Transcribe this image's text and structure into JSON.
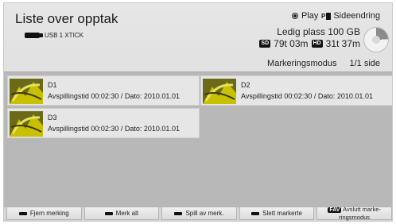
{
  "header": {
    "title": "Liste over opptak",
    "device_label": "USB 1 XTICK",
    "play_label": "Play",
    "page_change_label": "Sideendring",
    "free_space": "Ledig plass 100 GB",
    "sd_badge": "SD",
    "sd_time": "79t 03m",
    "hd_badge": "HD",
    "hd_time": "31t 37m",
    "mode_label": "Markeringsmodus",
    "page_indicator": "1/1 side"
  },
  "recordings": [
    {
      "name": "D1",
      "info": "Avspillingstid 00:02:30 / Dato: 2010.01.01"
    },
    {
      "name": "D2",
      "info": "Avspillingstid 00:02:30 / Dato: 2010.01.01"
    },
    {
      "name": "D3",
      "info": "Avspillingstid 00:02:30 / Dato: 2010.01.01"
    }
  ],
  "footer": {
    "buttons": [
      {
        "label": "Fjern merking"
      },
      {
        "label": "Merk alt"
      },
      {
        "label": "Spill av merk."
      },
      {
        "label": "Slett markerte"
      },
      {
        "badge": "FAV",
        "label_line1": "Avslutt marke-",
        "label_line2": "ringsmodus"
      }
    ]
  },
  "colors": {
    "background": "#d9d9d9",
    "list_area": "#b8b8b8",
    "item_background": "#e6e6e6",
    "badge": "#111111",
    "thumbnail_accent": "#c8c000"
  },
  "icons": [
    "usb-icon",
    "record-icon",
    "page-change-icon",
    "disk-usage-icon",
    "red-key-icon",
    "fav-key-icon"
  ]
}
